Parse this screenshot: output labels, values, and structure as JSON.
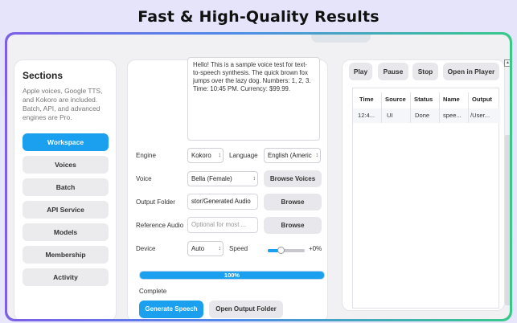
{
  "headline": "Fast & High-Quality Results",
  "sidebar": {
    "title": "Sections",
    "description": "Apple voices, Google TTS, and Kokoro are included. Batch, API, and advanced engines are Pro.",
    "items": [
      {
        "label": "Workspace",
        "active": true
      },
      {
        "label": "Voices"
      },
      {
        "label": "Batch"
      },
      {
        "label": "API Service"
      },
      {
        "label": "Models"
      },
      {
        "label": "Membership"
      },
      {
        "label": "Activity"
      }
    ]
  },
  "editor": {
    "text": "Hello! This is a sample voice test for text-to-speech synthesis. The quick brown fox jumps over the lazy dog. Numbers: 1, 2, 3. Time: 10:45 PM. Currency: $99.99.",
    "engine_label": "Engine",
    "engine_value": "Kokoro",
    "language_label": "Language",
    "language_value": "English (Americ",
    "voice_label": "Voice",
    "voice_value": "Bella (Female)",
    "browse_voices": "Browse Voices",
    "output_label": "Output Folder",
    "output_value": "stor/Generated Audio",
    "browse": "Browse",
    "reference_label": "Reference Audio",
    "reference_placeholder": "Optional for most ...",
    "device_label": "Device",
    "device_value": "Auto",
    "speed_label": "Speed",
    "speed_value": "+0%",
    "speed_level": 0.35,
    "progress_percent": 100,
    "progress_text": "100%",
    "status_text": "Complete",
    "generate_label": "Generate Speech",
    "open_folder_label": "Open Output Folder"
  },
  "player": {
    "play": "Play",
    "pause": "Pause",
    "stop": "Stop",
    "open_in_player": "Open in Player",
    "columns": [
      "Time",
      "Source",
      "Status",
      "Name",
      "Output"
    ],
    "rows": [
      [
        "12:4...",
        "UI",
        "Done",
        "spee...",
        "/User..."
      ]
    ]
  },
  "colors": {
    "accent": "#1aa0ee",
    "frame_gradient": [
      "#7d5fe6",
      "#4d8ce8",
      "#38c98a"
    ]
  }
}
